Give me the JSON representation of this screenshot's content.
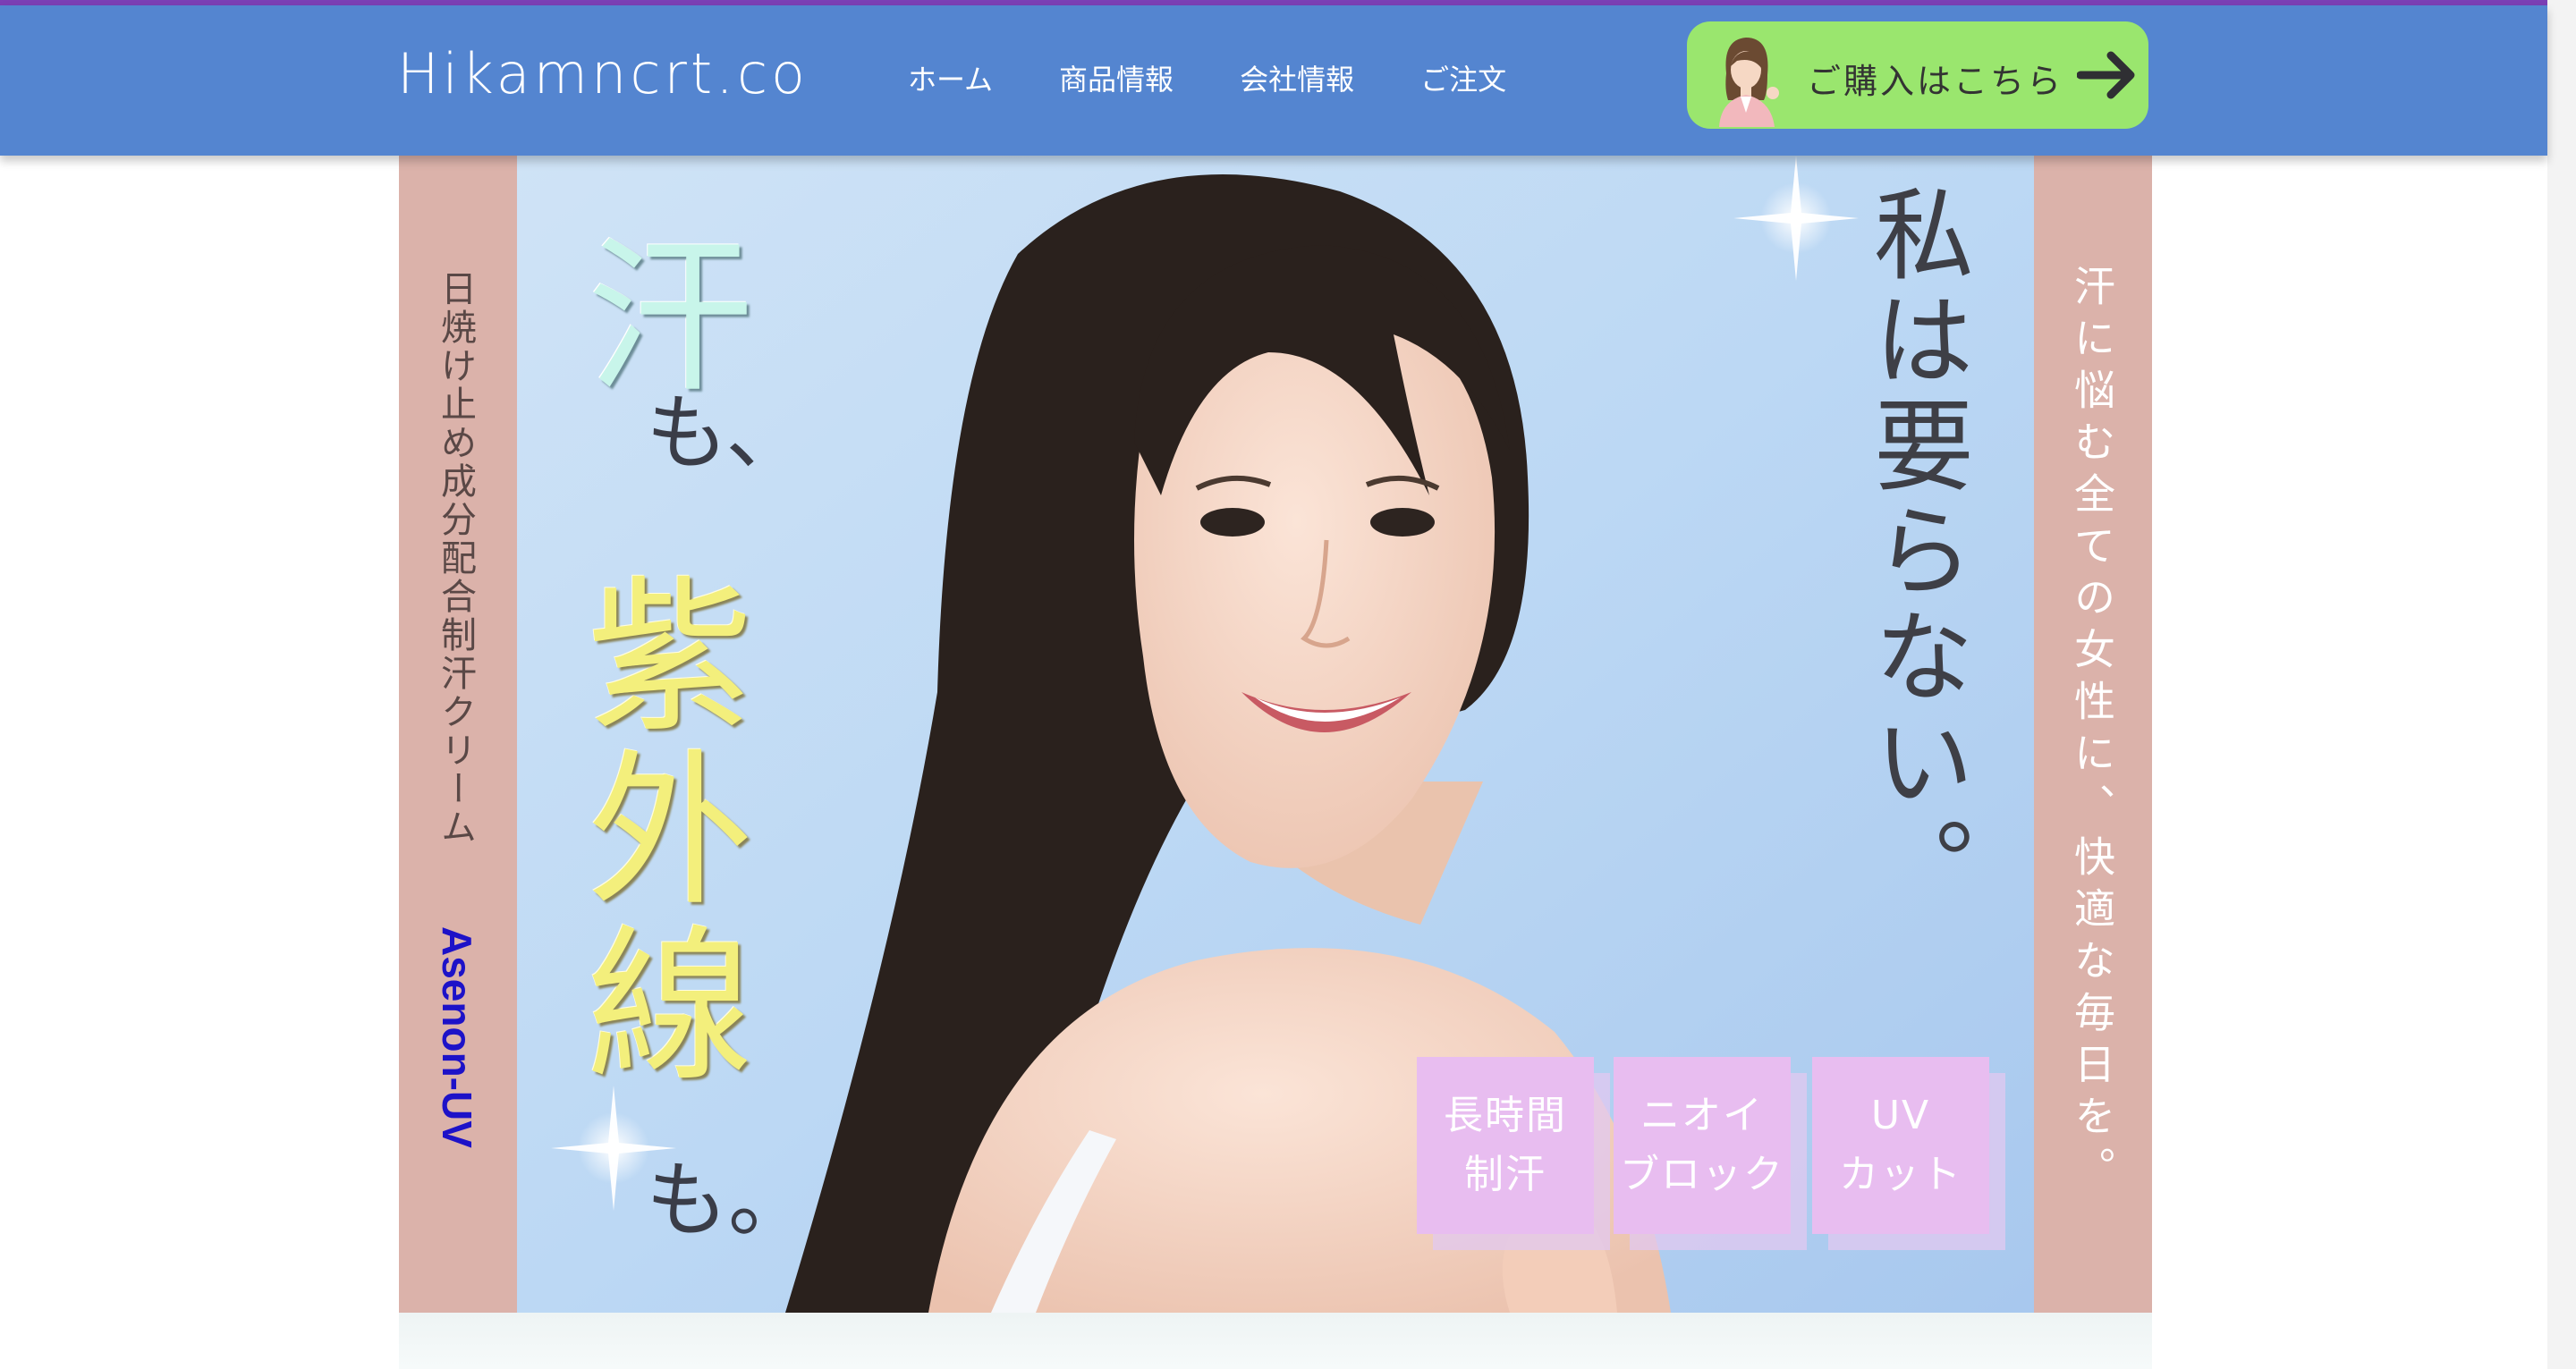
{
  "header": {
    "logo": "Hikamncrt.co",
    "nav": [
      "ホーム",
      "商品情報",
      "会社情報",
      "ご注文"
    ],
    "cta_label": "ご購入はこちら"
  },
  "hero": {
    "left_caption": "日焼け止め成分配合制汗クリーム",
    "brand": "Asenon-UV",
    "headline_ase": "汗",
    "headline_mo1": "も、",
    "headline_uv": [
      "紫",
      "外",
      "線"
    ],
    "headline_mo2": "も。",
    "tagline": "私は要らない。",
    "right_caption": "汗に悩む全ての女性に、快適な毎日を。",
    "features": [
      "長時間\n制汗",
      "ニオイ\nブロック",
      "UV\nカット"
    ]
  },
  "colors": {
    "header_bg": "#5485d0",
    "cta_bg": "#9ae66e",
    "side_panel": "#dbb2aa",
    "feature_box": "#e8bdf0",
    "brand_text": "#1d12c8"
  },
  "icons": [
    "woman-avatar-icon",
    "arrow-right-icon",
    "sparkle-icon"
  ]
}
